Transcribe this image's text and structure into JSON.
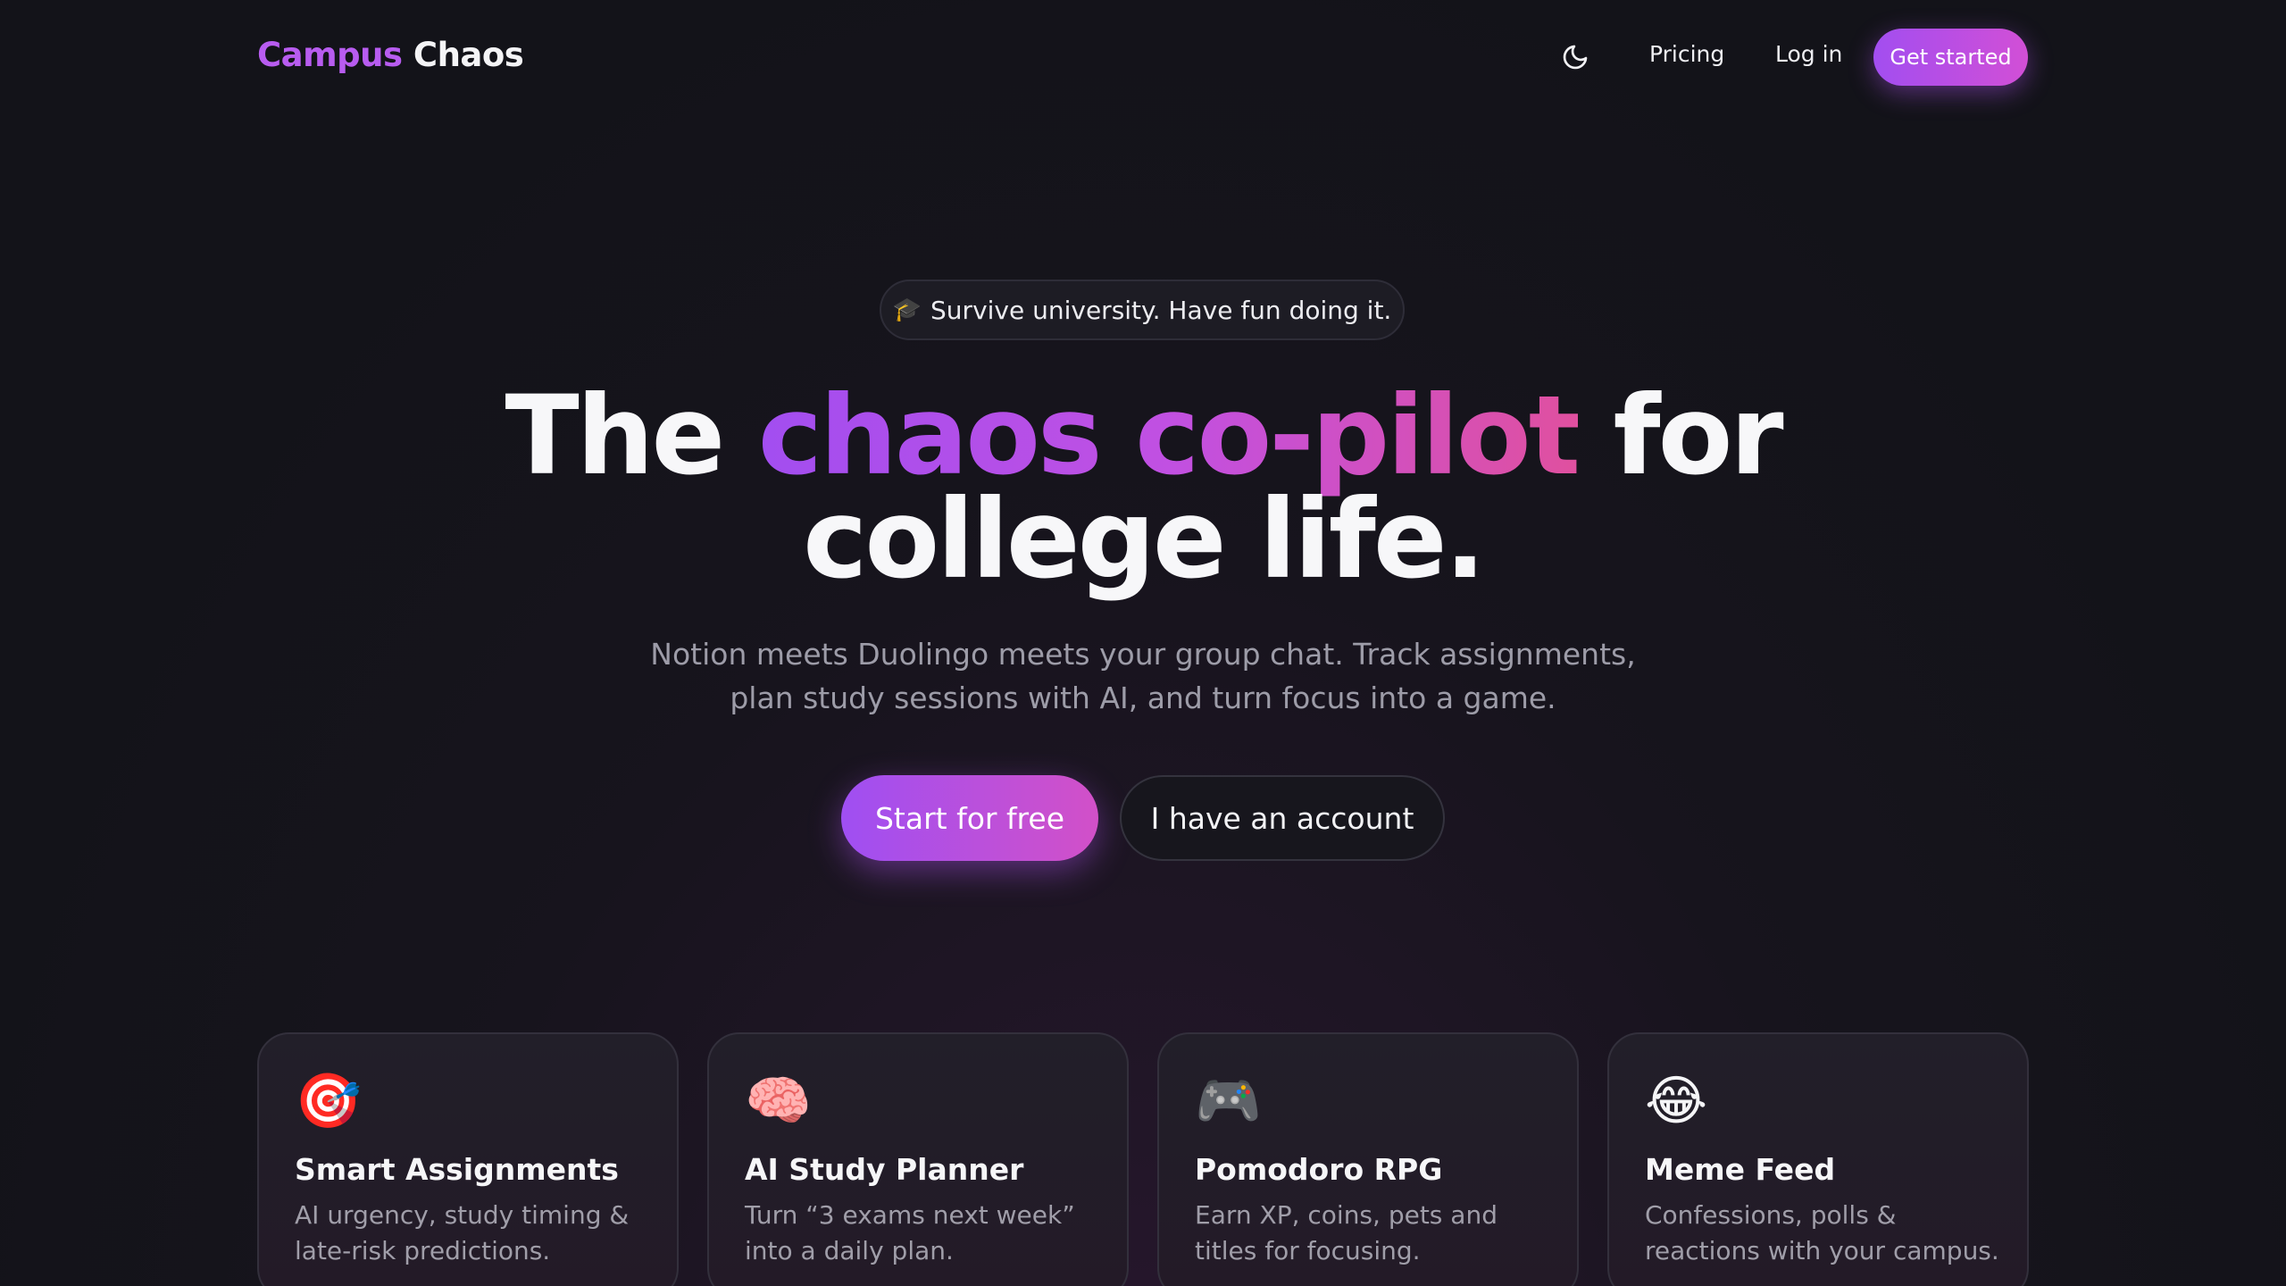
{
  "nav": {
    "logo_part1": "Campus",
    "logo_part2": "Chaos",
    "theme_toggle_icon": "moon-icon",
    "pricing": "Pricing",
    "login": "Log in",
    "cta": "Get started"
  },
  "hero": {
    "pill_icon": "🎓",
    "pill_text": "Survive university. Have fun doing it.",
    "headline_1": "The ",
    "headline_highlight": "chaos co-pilot",
    "headline_2": " for",
    "headline_3": "college life.",
    "subtitle_1": "Notion meets Duolingo meets your group chat. Track assignments,",
    "subtitle_2": "plan study sessions with AI, and turn focus into a game.",
    "primary_button": "Start for free",
    "secondary_button": "I have an account"
  },
  "features": [
    {
      "icon": "🎯",
      "title": "Smart Assignments",
      "desc": "AI urgency, study timing & late-risk predictions."
    },
    {
      "icon": "🧠",
      "title": "AI Study Planner",
      "desc": "Turn “3 exams next week” into a daily plan."
    },
    {
      "icon": "🎮",
      "title": "Pomodoro RPG",
      "desc": "Earn XP, coins, pets and titles for focusing."
    },
    {
      "icon": "😂",
      "title": "Meme Feed",
      "desc": "Confessions, polls & reactions with your campus."
    }
  ],
  "colors": {
    "accent_purple": "#a24ef0",
    "accent_pink": "#e0509f",
    "background": "#14141b"
  }
}
